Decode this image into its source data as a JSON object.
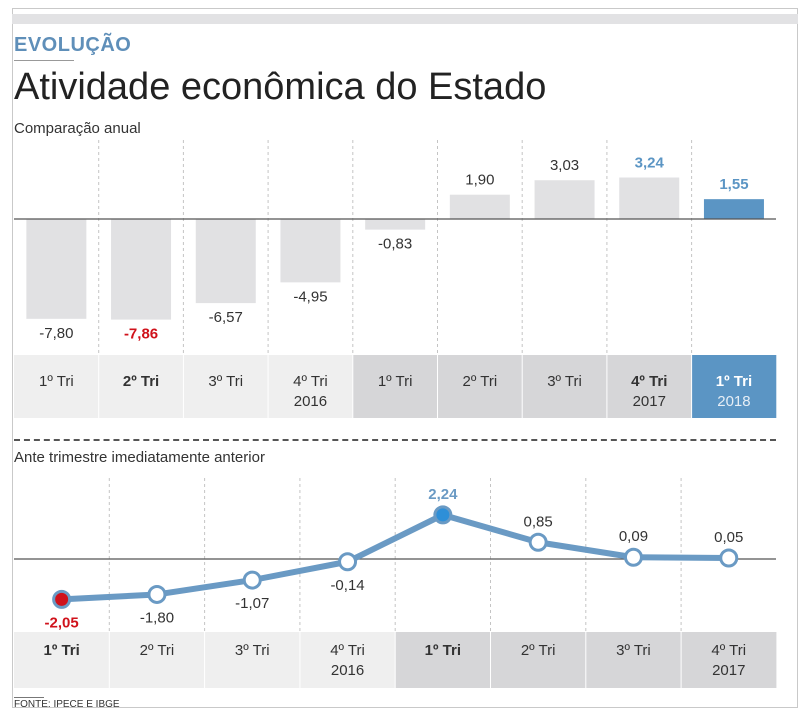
{
  "header": {
    "kicker": "EVOLUÇÃO",
    "title": "Atividade econômica do Estado",
    "subtitle_annual": "Comparação anual",
    "subtitle_quarterly": "Ante trimestre imediatamente anterior",
    "source": "FONTE: IPECE E IBGE"
  },
  "colors": {
    "bar": "#e1e1e3",
    "bar_highlight": "#5b95c4",
    "negative_highlight": "#d0121b",
    "line": "#6a9ac4",
    "marker_fill": "#ffffff",
    "marker_peak": "#2e8fd8",
    "marker_low": "#d0121b",
    "label_band_light": "#efefef",
    "label_band_dark": "#d6d6d8",
    "label_band_highlight": "#5b95c4"
  },
  "chart_data": [
    {
      "type": "bar",
      "title": "Comparação anual",
      "categories": [
        "1º Tri",
        "2º Tri",
        "3º Tri",
        "4º Tri",
        "1º Tri",
        "2º Tri",
        "3º Tri",
        "4º Tri",
        "1º Tri"
      ],
      "year_labels": [
        "",
        "",
        "",
        "2016",
        "",
        "",
        "",
        "2017",
        "2018"
      ],
      "values": [
        -7.8,
        -7.86,
        -6.57,
        -4.95,
        -0.83,
        1.9,
        3.03,
        3.24,
        1.55
      ],
      "value_labels": [
        "-7,80",
        "-7,86",
        "-6,57",
        "-4,95",
        "-0,83",
        "1,90",
        "3,03",
        "3,24",
        "1,55"
      ],
      "bold_categories": [
        1,
        7,
        8
      ],
      "highlight": 8
    },
    {
      "type": "line",
      "title": "Ante trimestre imediatamente anterior",
      "categories": [
        "1º Tri",
        "2º Tri",
        "3º Tri",
        "4º Tri",
        "1º Tri",
        "2º Tri",
        "3º Tri",
        "4º Tri"
      ],
      "year_labels": [
        "",
        "",
        "",
        "2016",
        "",
        "",
        "",
        "2017"
      ],
      "values": [
        -2.05,
        -1.8,
        -1.07,
        -0.14,
        2.24,
        0.85,
        0.09,
        0.05
      ],
      "value_labels": [
        "-2,05",
        "-1,80",
        "-1,07",
        "-0,14",
        "2,24",
        "0,85",
        "0,09",
        "0,05"
      ],
      "bold_categories": [
        0,
        4
      ],
      "min_point": 0,
      "max_point": 4
    }
  ]
}
